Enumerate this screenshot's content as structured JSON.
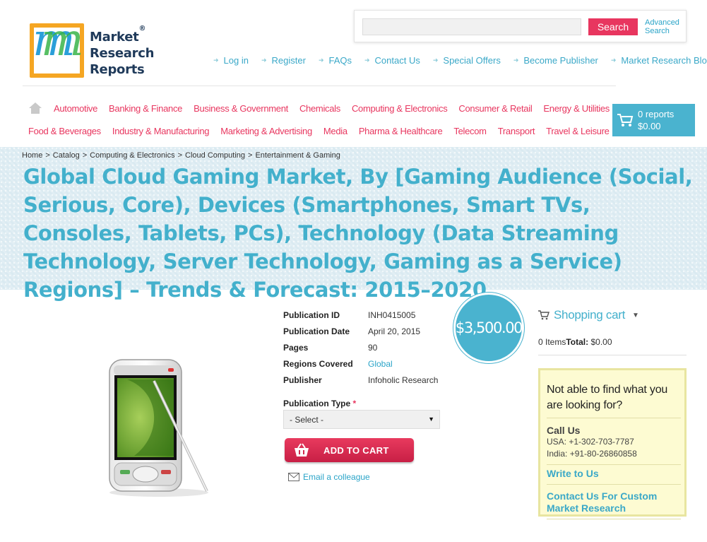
{
  "logo": {
    "line1": "Market",
    "line2": "Research",
    "line3": "Reports",
    "reg": "®",
    "colors": {
      "frame": "#f5a623",
      "m_blue": "#2b9fd9",
      "m_green": "#3ab54a",
      "text": "#1f3a5a"
    }
  },
  "search": {
    "placeholder": "",
    "button_label": "Search",
    "advanced_label": "Advanced Search"
  },
  "top_links": [
    "Log in",
    "Register",
    "FAQs",
    "Contact Us",
    "Special Offers",
    "Become Publisher",
    "Market Research Blog"
  ],
  "categories": {
    "row1": [
      "Automotive",
      "Banking & Finance",
      "Business & Government",
      "Chemicals",
      "Computing & Electronics",
      "Consumer & Retail",
      "Energy & Utilities"
    ],
    "row2": [
      "Food & Beverages",
      "Industry & Manufacturing",
      "Marketing & Advertising",
      "Media",
      "Pharma & Healthcare",
      "Telecom",
      "Transport",
      "Travel & Leisure"
    ]
  },
  "header_cart": {
    "reports": "0 reports",
    "total": "$0.00"
  },
  "breadcrumb": [
    "Home",
    "Catalog",
    "Computing & Electronics",
    "Cloud Computing",
    "Entertainment & Gaming"
  ],
  "breadcrumb_sep": ">",
  "title": "Global Cloud Gaming Market, By [Gaming Audience (Social, Serious, Core), Devices (Smartphones, Smart TVs, Consoles, Tablets, PCs), Technology (Data Streaming Technology, Server Technology, Gaming as a Service) Regions] – Trends & Forecast: 2015–2020",
  "product": {
    "fields": [
      {
        "label": "Publication ID",
        "value": "INH0415005",
        "link": false
      },
      {
        "label": "Publication Date",
        "value": "April 20, 2015",
        "link": false
      },
      {
        "label": "Pages",
        "value": "90",
        "link": false
      },
      {
        "label": "Regions Covered",
        "value": "Global",
        "link": true
      },
      {
        "label": "Publisher",
        "value": "Infoholic Research",
        "link": false
      }
    ],
    "price": "$3,500.00",
    "pub_type_label": "Publication Type",
    "pub_type_required": "*",
    "pub_type_selected": "- Select -",
    "add_to_cart_label": "ADD TO CART",
    "email_label": "Email a colleague"
  },
  "sidebar": {
    "cart_title": "Shopping cart",
    "items_count": "0 Items",
    "total_label": "Total:",
    "total_value": "$0.00",
    "help_question": "Not able to find what you are looking for?",
    "call_us": "Call Us",
    "phone_usa": "USA: +1-302-703-7787",
    "phone_india": "India: +91-80-26860858",
    "write_to_us": "Write to Us",
    "custom_research": "Contact Us For Custom Market Research"
  },
  "colors": {
    "accent_pink": "#e8365f",
    "accent_blue": "#43b0cc",
    "help_bg": "#fdfbd2"
  }
}
